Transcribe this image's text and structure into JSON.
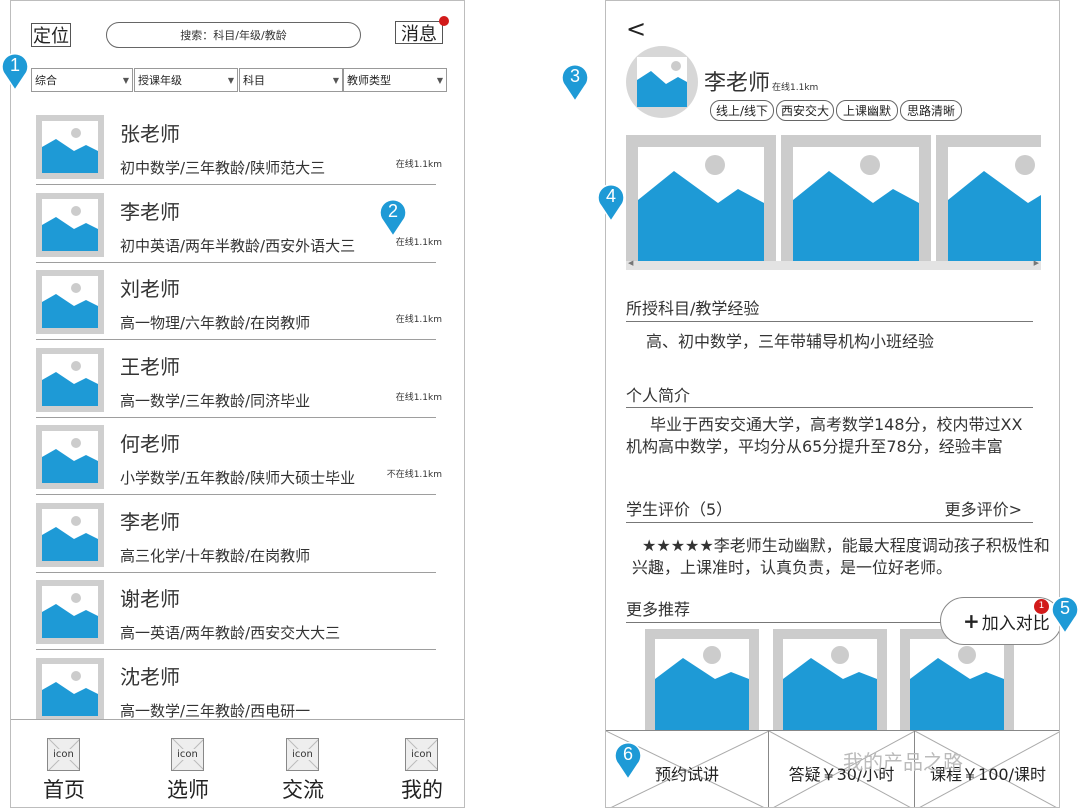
{
  "left_screen": {
    "locate_button": "定位",
    "search_placeholder": "搜索：科目/年级/教龄",
    "message_button": "消息",
    "filters": [
      "综合",
      "授课年级",
      "科目",
      "教师类型"
    ],
    "teachers": [
      {
        "name": "张老师",
        "desc": "初中数学/三年教龄/陕师范大三",
        "distance": "在线1.1km"
      },
      {
        "name": "李老师",
        "desc": "初中英语/两年半教龄/西安外语大三",
        "distance": "在线1.1km"
      },
      {
        "name": "刘老师",
        "desc": "高一物理/六年教龄/在岗教师",
        "distance": "在线1.1km"
      },
      {
        "name": "王老师",
        "desc": "高一数学/三年教龄/同济毕业",
        "distance": "在线1.1km"
      },
      {
        "name": "何老师",
        "desc": "小学数学/五年教龄/陕师大硕士毕业",
        "distance": "不在线1.1km"
      },
      {
        "name": "李老师",
        "desc": "高三化学/十年教龄/在岗教师",
        "distance": ""
      },
      {
        "name": "谢老师",
        "desc": "高一英语/两年教龄/西安交大大三",
        "distance": ""
      },
      {
        "name": "沈老师",
        "desc": "高一数学/三年教龄/西电研一",
        "distance": ""
      }
    ],
    "tabs": [
      {
        "icon": "icon",
        "label": "首页"
      },
      {
        "icon": "icon",
        "label": "选师"
      },
      {
        "icon": "icon",
        "label": "交流"
      },
      {
        "icon": "icon",
        "label": "我的"
      }
    ]
  },
  "right_screen": {
    "back": "<",
    "teacher_name": "李老师",
    "online": "在线1.1km",
    "tags": [
      "线上/线下",
      "西安交大",
      "上课幽默",
      "思路清晰"
    ],
    "subjects_title": "所授科目/教学经验",
    "subjects_text": "高、初中数学，三年带辅导机构小班经验",
    "intro_title": "个人简介",
    "intro_text": "毕业于西安交通大学，高考数学148分，校内带过XX机构高中数学，平均分从65分提升至78分，经验丰富",
    "reviews_title": "学生评价（5）",
    "reviews_more": "更多评价>",
    "review_text": "★★★★★李老师生动幽默，能最大程度调动孩子积极性和兴趣，上课准时，认真负责，是一位好老师。",
    "recommend_title": "更多推荐",
    "compare_button": "加入对比",
    "compare_plus": "+",
    "compare_badge": "1",
    "bottom": [
      "预约试讲",
      "答疑￥30/小时",
      "课程￥100/课时"
    ]
  },
  "markers": [
    "1",
    "2",
    "3",
    "4",
    "5",
    "6"
  ],
  "watermark": "我的产品之路",
  "colors": {
    "accent_blue": "#1e9ad6",
    "badge_red": "#d21a1a",
    "placeholder_gray": "#cccccc"
  }
}
